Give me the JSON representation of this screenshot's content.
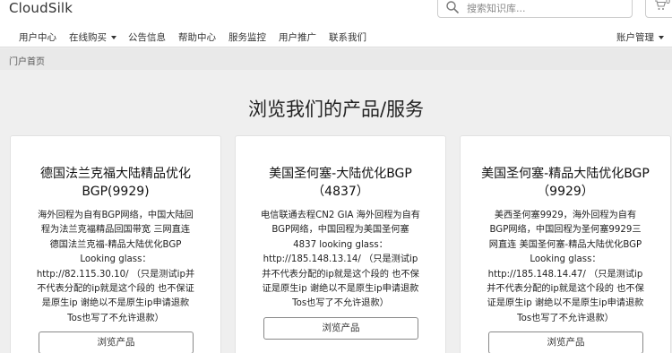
{
  "header": {
    "brand": "CloudSilk",
    "search_placeholder": "搜索知识库...",
    "cart_count": "0"
  },
  "nav": {
    "items": [
      "用户中心",
      "在线购买",
      "公告信息",
      "帮助中心",
      "服务监控",
      "用户推广",
      "联系我们"
    ],
    "account": "账户管理"
  },
  "breadcrumb": "门户首页",
  "page_title": "浏览我们的产品/服务",
  "cards": [
    {
      "title": "德国法兰克福大陆精品优化BGP(9929)",
      "desc": "海外回程为自有BGP网络，中国大陆回程为法兰克福精品回国带宽 三网直连 德国法兰克福-精品大陆优化BGP Looking glass：http://82.115.30.10/ （只是测试ip并不代表分配的ip就是这个段的 也不保证是原生ip 谢绝以不是原生ip申请退款 Tos也写了不允许退款）",
      "button": "浏览产品"
    },
    {
      "title": "美国圣何塞-大陆优化BGP（4837）",
      "desc": "电信联通去程CN2 GIA 海外回程为自有BGP网络，中国回程为美国圣何塞4837 looking glass：http://185.148.13.14/ （只是测试ip并不代表分配的ip就是这个段的 也不保证是原生ip 谢绝以不是原生ip申请退款 Tos也写了不允许退款）",
      "button": "浏览产品"
    },
    {
      "title": "美国圣何塞-精品大陆优化BGP（9929）",
      "desc": "美西圣何塞9929，海外回程为自有BGP网络，中国回程为圣何塞9929三网直连 美国圣何塞-精品大陆优化BGP Looking glass：http://185.148.14.47/ （只是测试ip并不代表分配的ip就是这个段的 也不保证是原生ip 谢绝以不是原生ip申请退款 Tos也写了不允许退款）",
      "button": "浏览产品"
    }
  ]
}
